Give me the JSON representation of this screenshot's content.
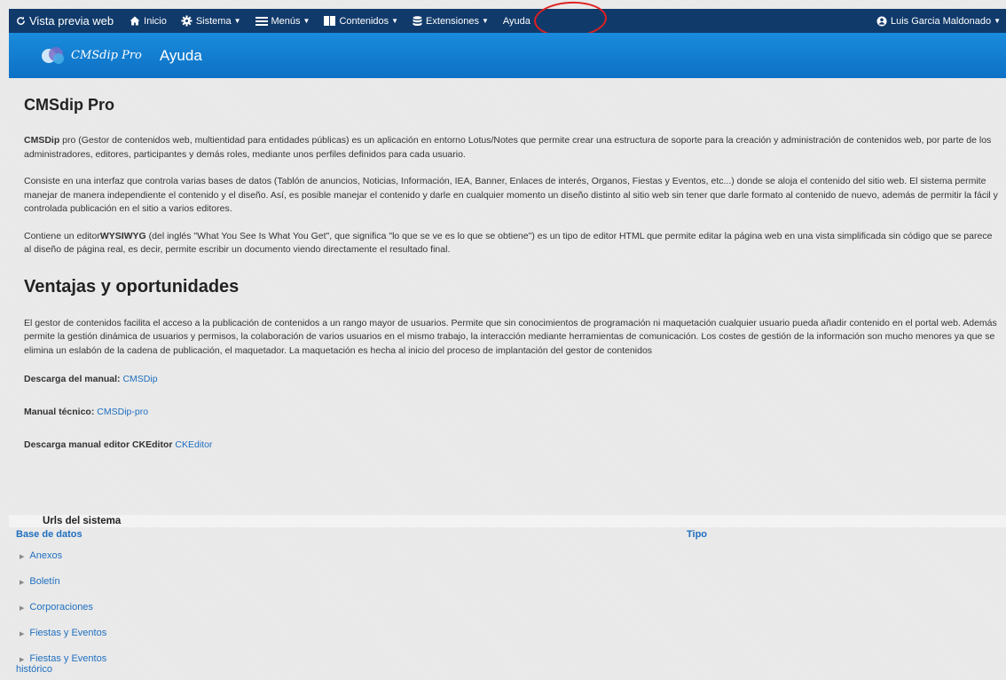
{
  "topbar": {
    "brand": "Vista previa web",
    "items": [
      {
        "label": "Inicio"
      },
      {
        "label": "Sistema"
      },
      {
        "label": "Menús"
      },
      {
        "label": "Contenidos"
      },
      {
        "label": "Extensiones"
      },
      {
        "label": "Ayuda"
      }
    ],
    "user": "Luis Garcia Maldonado"
  },
  "header": {
    "logo_text": "CMSdip Pro",
    "title": "Ayuda"
  },
  "content": {
    "title": "CMSdip Pro",
    "p1_bold": "CMSDip",
    "p1_rest": " pro (Gestor de contenidos web, multientidad para entidades públicas) es un aplicación en entorno Lotus/Notes que permite crear una estructura de soporte para la creación y administración de contenidos web, por parte de los administradores, editores, participantes y demás roles, mediante unos perfiles definidos para cada usuario.",
    "p2": "Consiste en una interfaz que controla varias bases de datos (Tablón de anuncios, Noticias, Información, IEA, Banner, Enlaces de interés, Organos, Fiestas y Eventos, etc...) donde se aloja el contenido del sitio web. El sistema permite manejar de manera independiente el contenido y el diseño. Así, es posible manejar el contenido y darle en cualquier momento un diseño distinto al sitio web sin tener que darle formato al contenido de nuevo, además de permitir la fácil y controlada publicación en el sitio a varios editores.",
    "p3_pre": "Contiene un editor",
    "p3_bold": "WYSIWYG",
    "p3_rest": " (del inglés \"What You See Is What You Get\", que significa \"lo que se ve es lo que se obtiene\") es un tipo de editor HTML que permite editar la página web en una vista simplificada sin código que se parece al diseño de página real, es decir, permite escribir un documento viendo directamente el resultado final.",
    "subtitle": "Ventajas y oportunidades",
    "p4": "El gestor de contenidos facilita el acceso a la publicación de contenidos a un rango mayor de usuarios. Permite que sin conocimientos de programación ni maquetación cualquier usuario pueda añadir contenido en el portal web. Además permite la gestión dinámica de usuarios y permisos, la colaboración de varios usuarios en el mismo trabajo, la interacción mediante herramientas de comunicación. Los costes de gestión de la información son mucho menores ya que se elimina un eslabón de la cadena de publicación, el maquetador. La maquetación es hecha al inicio del proceso de implantación del gestor de contenidos",
    "downloads": [
      {
        "label": "Descarga del manual:",
        "link": "CMSDip"
      },
      {
        "label": "Manual técnico:",
        "link": "CMSDip-pro"
      },
      {
        "label": "Descarga manual editor CKEditor",
        "link": "CKEditor"
      }
    ]
  },
  "urls": {
    "title": "Urls del sistema",
    "col1": "Base de datos",
    "col2": "Tipo",
    "rows": [
      "Anexos",
      "Boletín",
      "Corporaciones",
      "Fiestas y Eventos"
    ],
    "last_row": {
      "line1": "Fiestas y Eventos",
      "line2": "histórico"
    }
  },
  "colors": {
    "topbar_bg": "#103a6a",
    "header_bg": "#1a8bdc",
    "link": "#1f6fbf"
  }
}
